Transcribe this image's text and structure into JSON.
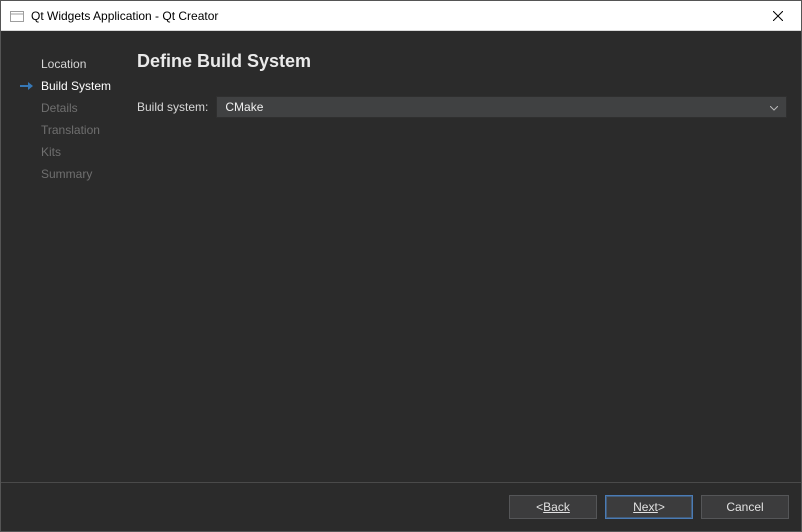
{
  "titlebar": {
    "title": "Qt Widgets Application - Qt Creator"
  },
  "sidebar": {
    "steps": [
      {
        "label": "Location",
        "state": "done"
      },
      {
        "label": "Build System",
        "state": "current"
      },
      {
        "label": "Details",
        "state": "pending"
      },
      {
        "label": "Translation",
        "state": "pending"
      },
      {
        "label": "Kits",
        "state": "pending"
      },
      {
        "label": "Summary",
        "state": "pending"
      }
    ]
  },
  "page": {
    "title": "Define Build System",
    "build_system_label": "Build system:",
    "build_system_value": "CMake"
  },
  "footer": {
    "back": "Back",
    "next": "Next",
    "cancel": "Cancel"
  }
}
